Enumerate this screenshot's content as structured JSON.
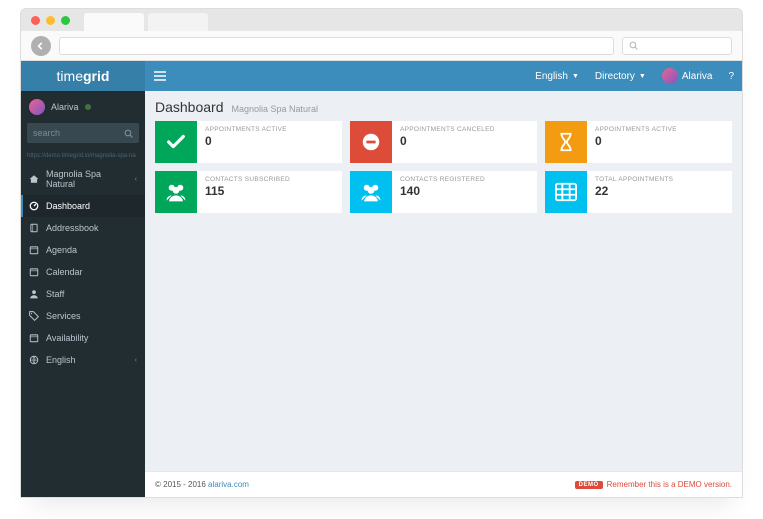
{
  "topbar": {
    "brand_a": "time",
    "brand_b": "grid",
    "lang": "English",
    "dir": "Directory",
    "user": "Alariva",
    "help": "?"
  },
  "sidebar": {
    "user": "Alariva",
    "search_placeholder": "search",
    "url": "https://demo.timegrid.io/magnolia-spa-na",
    "items": [
      {
        "icon": "home",
        "label": "Magnolia Spa Natural",
        "expand": true
      },
      {
        "icon": "dash",
        "label": "Dashboard",
        "active": true
      },
      {
        "icon": "book",
        "label": "Addressbook"
      },
      {
        "icon": "cal",
        "label": "Agenda"
      },
      {
        "icon": "cal",
        "label": "Calendar"
      },
      {
        "icon": "user",
        "label": "Staff"
      },
      {
        "icon": "tag",
        "label": "Services"
      },
      {
        "icon": "cal",
        "label": "Availability"
      },
      {
        "icon": "globe",
        "label": "English",
        "expand": true
      }
    ]
  },
  "header": {
    "title": "Dashboard",
    "subtitle": "Magnolia Spa Natural"
  },
  "cards": [
    {
      "color": "green",
      "icon": "check",
      "label": "APPOINTMENTS ACTIVE",
      "value": "0"
    },
    {
      "color": "red",
      "icon": "stop",
      "label": "APPOINTMENTS CANCELED",
      "value": "0"
    },
    {
      "color": "orange",
      "icon": "hour",
      "label": "APPOINTMENTS ACTIVE",
      "value": "0"
    },
    {
      "color": "green",
      "icon": "users",
      "label": "CONTACTS SUBSCRIBED",
      "value": "115"
    },
    {
      "color": "blue",
      "icon": "users",
      "label": "CONTACTS REGISTERED",
      "value": "140"
    },
    {
      "color": "blue",
      "icon": "grid",
      "label": "TOTAL APPOINTMENTS",
      "value": "22"
    }
  ],
  "footer": {
    "copy": "© 2015 - 2016 ",
    "link": "alariva.com",
    "demo_badge": "DEMO",
    "demo_text": "Remember this is a DEMO version."
  }
}
